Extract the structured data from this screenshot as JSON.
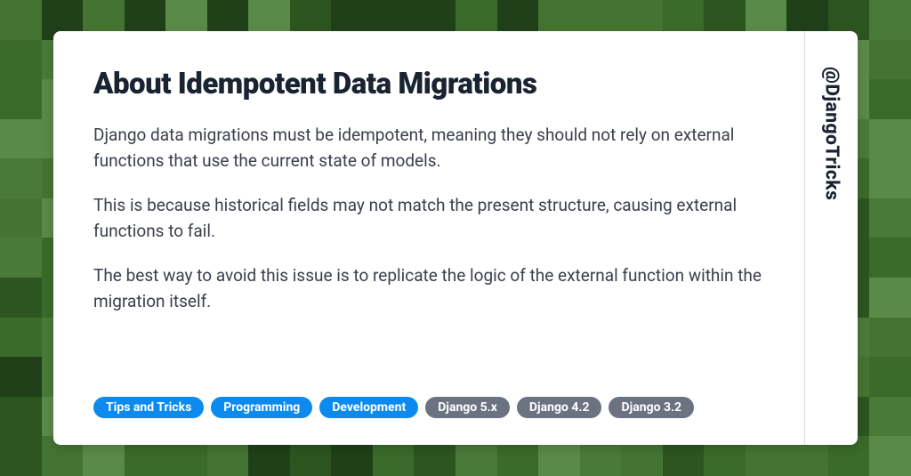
{
  "title": "About Idempotent Data Migrations",
  "paragraphs": [
    "Django data migrations must be idempotent, meaning they should not rely on external functions that use the current state of models.",
    "This is because historical fields may not match the present structure, causing external functions to fail.",
    "The best way to avoid this issue is to replicate the logic of the external function within the migration itself."
  ],
  "tags": [
    {
      "label": "Tips and Tricks",
      "style": "blue"
    },
    {
      "label": "Programming",
      "style": "blue"
    },
    {
      "label": "Development",
      "style": "blue"
    },
    {
      "label": "Django 5.x",
      "style": "gray"
    },
    {
      "label": "Django 4.2",
      "style": "gray"
    },
    {
      "label": "Django 3.2",
      "style": "gray"
    }
  ],
  "handle": "@DjangoTricks",
  "bg_colors": [
    "#2d5520",
    "#3a6b2a",
    "#4a7a38",
    "#5a8a48",
    "#1f4018",
    "#457432"
  ]
}
